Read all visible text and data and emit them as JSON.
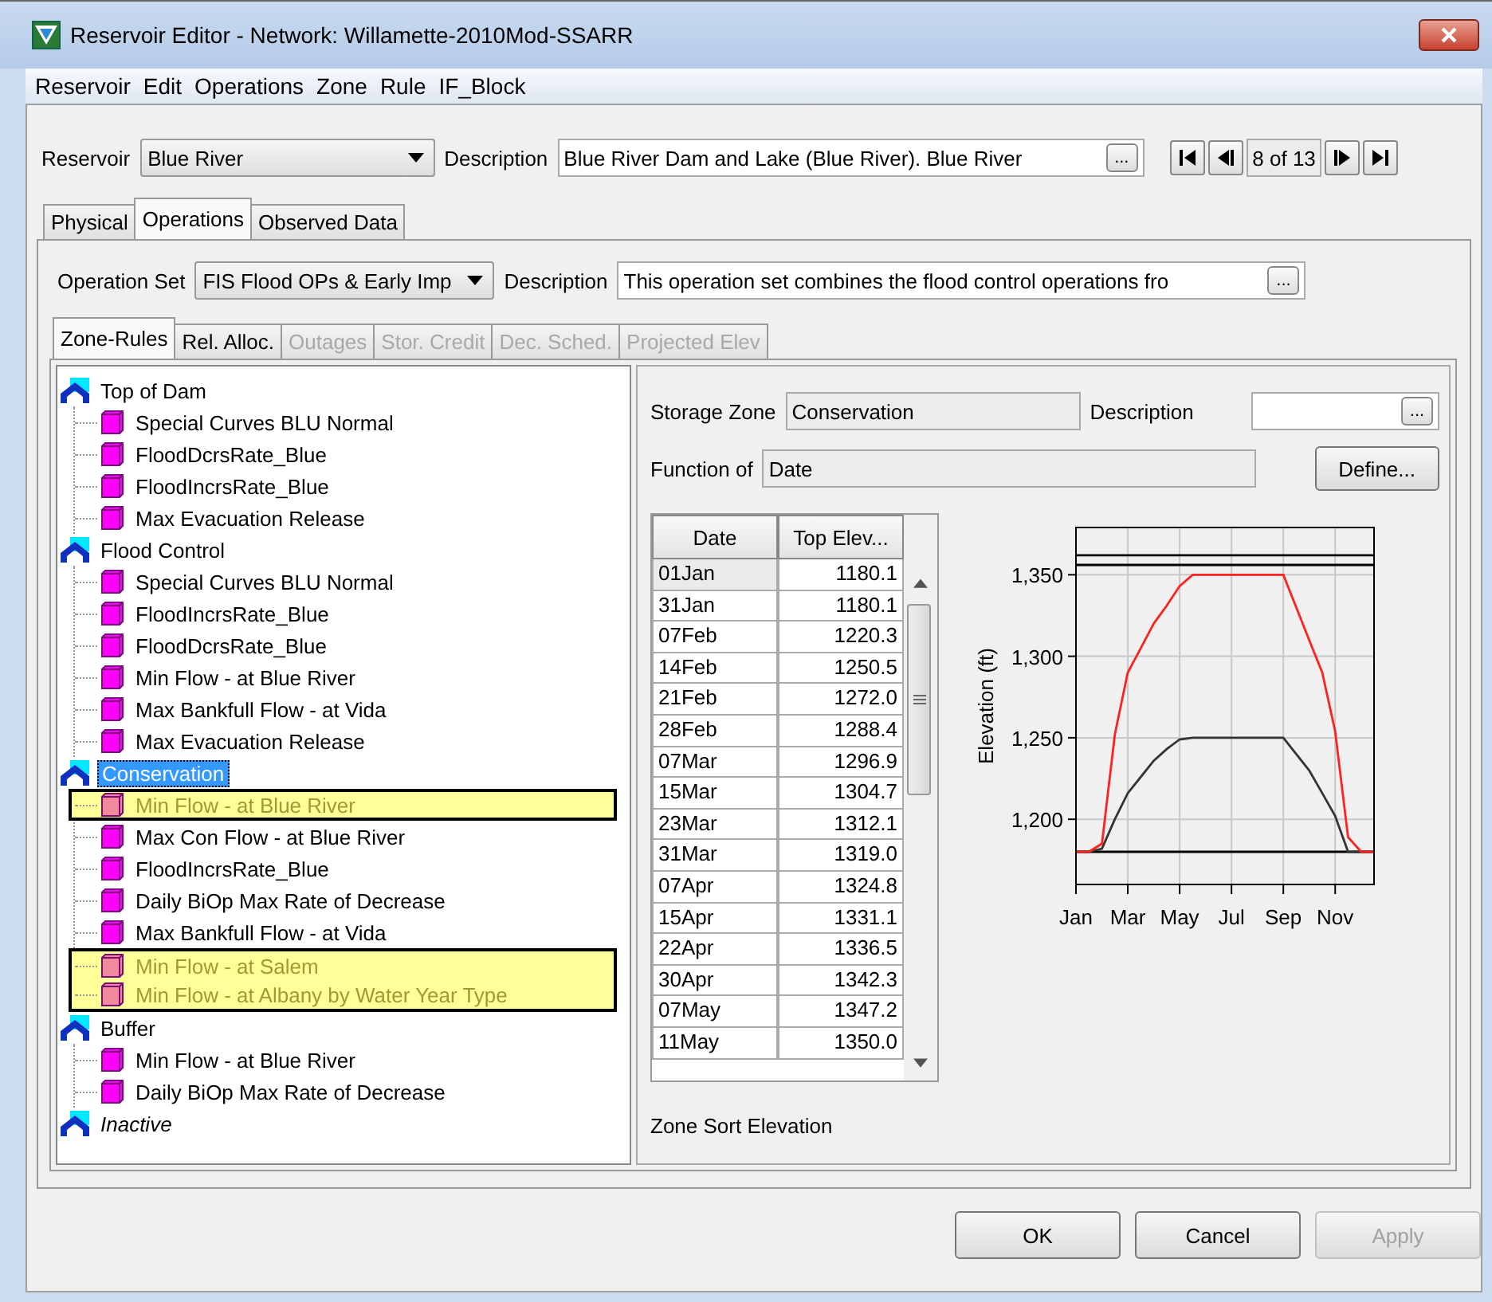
{
  "window": {
    "title": "Reservoir Editor - Network: Willamette-2010Mod-SSARR"
  },
  "menu": [
    "Reservoir",
    "Edit",
    "Operations",
    "Zone",
    "Rule",
    "IF_Block"
  ],
  "reservoir": {
    "label": "Reservoir",
    "value": "Blue River",
    "description_label": "Description",
    "description": "Blue River Dam and Lake (Blue River).  Blue River",
    "more": "...",
    "position": "8 of 13"
  },
  "tabs": [
    {
      "label": "Physical",
      "selected": false
    },
    {
      "label": "Operations",
      "selected": true
    },
    {
      "label": "Observed Data",
      "selected": false
    }
  ],
  "operation_set": {
    "label": "Operation Set",
    "value": "FIS Flood OPs & Early Imp",
    "description_label": "Description",
    "description": "This operation set combines the flood control operations fro",
    "more": "..."
  },
  "sub_tabs": [
    {
      "label": "Zone-Rules",
      "selected": true,
      "disabled": false
    },
    {
      "label": "Rel. Alloc.",
      "selected": false,
      "disabled": false
    },
    {
      "label": "Outages",
      "selected": false,
      "disabled": true
    },
    {
      "label": "Stor. Credit",
      "selected": false,
      "disabled": true
    },
    {
      "label": "Dec. Sched.",
      "selected": false,
      "disabled": true
    },
    {
      "label": "Projected Elev",
      "selected": false,
      "disabled": true
    }
  ],
  "tree": [
    {
      "label": "Top of Dam",
      "selected": false,
      "active": true,
      "children": [
        {
          "label": "Special Curves BLU Normal",
          "highlighted": false
        },
        {
          "label": "FloodDcrsRate_Blue",
          "highlighted": false
        },
        {
          "label": "FloodIncrsRate_Blue",
          "highlighted": false
        },
        {
          "label": "Max Evacuation Release",
          "highlighted": false
        }
      ]
    },
    {
      "label": "Flood Control",
      "selected": false,
      "active": true,
      "children": [
        {
          "label": "Special Curves BLU Normal",
          "highlighted": false
        },
        {
          "label": "FloodIncrsRate_Blue",
          "highlighted": false
        },
        {
          "label": "FloodDcrsRate_Blue",
          "highlighted": false
        },
        {
          "label": "Min Flow - at Blue River",
          "highlighted": false
        },
        {
          "label": "Max Bankfull Flow - at Vida",
          "highlighted": false
        },
        {
          "label": "Max Evacuation Release",
          "highlighted": false
        }
      ]
    },
    {
      "label": "Conservation",
      "selected": true,
      "active": true,
      "children": [
        {
          "label": "Min Flow - at Blue River",
          "highlighted": true
        },
        {
          "label": "Max Con Flow - at Blue River",
          "highlighted": false
        },
        {
          "label": "FloodIncrsRate_Blue",
          "highlighted": false
        },
        {
          "label": "Daily BiOp Max Rate of Decrease",
          "highlighted": false
        },
        {
          "label": "Max Bankfull Flow - at Vida",
          "highlighted": false
        },
        {
          "label": "Min Flow - at Salem",
          "highlighted": true
        },
        {
          "label": "Min Flow - at Albany by Water Year Type",
          "highlighted": true
        }
      ]
    },
    {
      "label": "Buffer",
      "selected": false,
      "active": true,
      "children": [
        {
          "label": "Min Flow - at Blue River",
          "highlighted": false
        },
        {
          "label": "Daily BiOp Max Rate of Decrease",
          "highlighted": false
        }
      ]
    },
    {
      "label": "Inactive",
      "selected": false,
      "active": false
    }
  ],
  "zone": {
    "storage_zone_label": "Storage Zone",
    "storage_zone": "Conservation",
    "description_label": "Description",
    "more": "...",
    "function_label": "Function of",
    "function": "Date",
    "define_button": "Define...",
    "sort_label": "Zone Sort Elevation"
  },
  "table": {
    "columns": [
      "Date",
      "Top Elev..."
    ],
    "rows": [
      {
        "cells": [
          "01Jan",
          "1180.1"
        ],
        "selected": true
      },
      {
        "cells": [
          "31Jan",
          "1180.1"
        ],
        "selected": false
      },
      {
        "cells": [
          "07Feb",
          "1220.3"
        ],
        "selected": false
      },
      {
        "cells": [
          "14Feb",
          "1250.5"
        ],
        "selected": false
      },
      {
        "cells": [
          "21Feb",
          "1272.0"
        ],
        "selected": false
      },
      {
        "cells": [
          "28Feb",
          "1288.4"
        ],
        "selected": false
      },
      {
        "cells": [
          "07Mar",
          "1296.9"
        ],
        "selected": false
      },
      {
        "cells": [
          "15Mar",
          "1304.7"
        ],
        "selected": false
      },
      {
        "cells": [
          "23Mar",
          "1312.1"
        ],
        "selected": false
      },
      {
        "cells": [
          "31Mar",
          "1319.0"
        ],
        "selected": false
      },
      {
        "cells": [
          "07Apr",
          "1324.8"
        ],
        "selected": false
      },
      {
        "cells": [
          "15Apr",
          "1331.1"
        ],
        "selected": false
      },
      {
        "cells": [
          "22Apr",
          "1336.5"
        ],
        "selected": false
      },
      {
        "cells": [
          "30Apr",
          "1342.3"
        ],
        "selected": false
      },
      {
        "cells": [
          "07May",
          "1347.2"
        ],
        "selected": false
      },
      {
        "cells": [
          "11May",
          "1350.0"
        ],
        "selected": false
      }
    ]
  },
  "chart_data": {
    "type": "line",
    "ylabel": "Elevation (ft)",
    "categories": [
      "Jan",
      null,
      null,
      null,
      "Mar",
      null,
      null,
      null,
      "May",
      null,
      null,
      null,
      "Jul",
      null,
      null,
      null,
      "Sep",
      null,
      null,
      null,
      "Nov",
      null,
      null,
      null
    ],
    "series": [
      {
        "color": "#000000",
        "values": [
          1362,
          1362,
          1362,
          1362,
          1362,
          1362,
          1362,
          1362,
          1362,
          1362,
          1362,
          1362,
          1362,
          1362,
          1362,
          1362,
          1362,
          1362,
          1362,
          1362,
          1362,
          1362,
          1362,
          1362
        ]
      },
      {
        "color": "#000000",
        "values": [
          1356,
          1356,
          1356,
          1356,
          1356,
          1356,
          1356,
          1356,
          1356,
          1356,
          1356,
          1356,
          1356,
          1356,
          1356,
          1356,
          1356,
          1356,
          1356,
          1356,
          1356,
          1356,
          1356,
          1356
        ]
      },
      {
        "color": "#000000",
        "values": [
          1180,
          1180,
          1180,
          1180,
          1180,
          1180,
          1180,
          1180,
          1180,
          1180,
          1180,
          1180,
          1180,
          1180,
          1180,
          1180,
          1180,
          1180,
          1180,
          1180,
          1180,
          1180,
          1180,
          1180
        ]
      },
      {
        "color": "#333333",
        "values": [
          1180,
          1180,
          1182,
          1200,
          1216,
          1226,
          1236,
          1243,
          1249,
          1250,
          1250,
          1250,
          1250,
          1250,
          1250,
          1250,
          1250,
          1240,
          1230,
          1216,
          1202,
          1180,
          1180,
          1180
        ]
      },
      {
        "color": "#ff2020",
        "values": [
          1180,
          1180,
          1185,
          1252,
          1290,
          1305,
          1320,
          1331,
          1343,
          1350,
          1350,
          1350,
          1350,
          1350,
          1350,
          1350,
          1350,
          1330,
          1310,
          1290,
          1254,
          1189,
          1180,
          1180
        ]
      }
    ],
    "grid": true,
    "ylim": [
      1160,
      1379
    ],
    "yticks": [
      {
        "value": 1200,
        "label": "1,200"
      },
      {
        "value": 1250,
        "label": "1,250"
      },
      {
        "value": 1300,
        "label": "1,300"
      },
      {
        "value": 1350,
        "label": "1,350"
      }
    ]
  },
  "buttons": [
    {
      "label": "OK",
      "disabled": false
    },
    {
      "label": "Cancel",
      "disabled": false
    },
    {
      "label": "Apply",
      "disabled": true
    }
  ]
}
